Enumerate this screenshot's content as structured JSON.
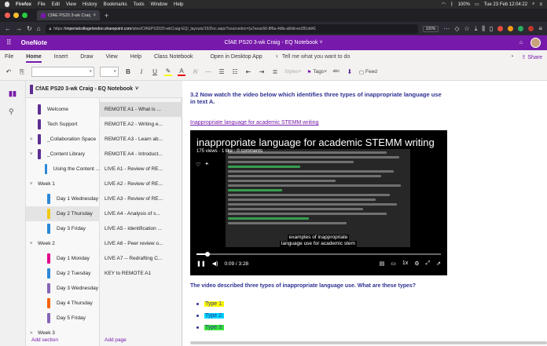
{
  "mac_menu": {
    "app": "Firefox",
    "items": [
      "File",
      "Edit",
      "View",
      "History",
      "Bookmarks",
      "Tools",
      "Window",
      "Help"
    ],
    "battery": "100%",
    "clock": "Tue 23 Feb 12:04:22"
  },
  "browser": {
    "tab_title": "CfAE PS20 3-wk Craig - EQ",
    "url_host": "imperialcollegelondon.sharepoint.com",
    "url_rest": "/sites/CfAEPS2020-wkCraig-EQ/_layouts/15/Doc.aspx?sourcedoc={a7eeac66-8f6a-4dfa-a8dd-ee281dd41",
    "zoom": "100%"
  },
  "onenote": {
    "app_name": "OneNote",
    "doc_title": "CfAE PS20 3-wk Craig - EQ Notebook ˅",
    "ribbon_tabs": [
      "File",
      "Home",
      "Insert",
      "Draw",
      "View",
      "Help",
      "Class Notebook"
    ],
    "open_desktop": "Open in Desktop App",
    "tell_me": "Tell me what you want to do",
    "share": "Share",
    "toolbar": {
      "styles": "Styles",
      "tags": "Tags",
      "feed": "Feed",
      "bold": "B",
      "italic": "I",
      "underline": "U"
    }
  },
  "notebook_name": "CfAE PS20 3-wk Craig - EQ Notebook",
  "sections": [
    {
      "label": "Welcome",
      "color": "#5c2d91",
      "chevron": "",
      "selected": false
    },
    {
      "label": "Tech Support",
      "color": "#5c2d91",
      "chevron": "",
      "selected": false
    },
    {
      "label": "_Collaboration Space",
      "color": "#5c2d91",
      "chevron": ">",
      "selected": false
    },
    {
      "label": "_Content Library",
      "color": "#5c2d91",
      "chevron": "˅",
      "selected": false
    },
    {
      "label": "Using the Content ...",
      "color": "#2b88d8",
      "chevron": "",
      "selected": false
    },
    {
      "label": "Week 1",
      "color": "",
      "chevron": "˅",
      "selected": false
    },
    {
      "label": "Day 1 Wednesday",
      "color": "#2b88d8",
      "chevron": "",
      "selected": false
    },
    {
      "label": "Day 2 Thursday",
      "color": "#f2c811",
      "chevron": "",
      "selected": true
    },
    {
      "label": "Day 3 Friday",
      "color": "#2b88d8",
      "chevron": "",
      "selected": false
    },
    {
      "label": "Week 2",
      "color": "",
      "chevron": "˅",
      "selected": false
    },
    {
      "label": "Day 1 Monday",
      "color": "#e3008c",
      "chevron": "",
      "selected": false
    },
    {
      "label": "Day 2 Tuesday",
      "color": "#2b88d8",
      "chevron": "",
      "selected": false
    },
    {
      "label": "Day 3 Wednesday",
      "color": "#8764b8",
      "chevron": "",
      "selected": false
    },
    {
      "label": "Day 4 Thursday",
      "color": "#f7630c",
      "chevron": "",
      "selected": false
    },
    {
      "label": "Day 5 Friday",
      "color": "#8764b8",
      "chevron": "",
      "selected": false
    },
    {
      "label": "Week 3",
      "color": "",
      "chevron": ">",
      "selected": false
    }
  ],
  "pages": [
    {
      "label": "REMOTE A1 - What is ...",
      "selected": true
    },
    {
      "label": "REMOTE A2 - Writing e...",
      "selected": false
    },
    {
      "label": "REMOTE A3 - Learn ab...",
      "selected": false
    },
    {
      "label": "REMOTE A4 - Introduct...",
      "selected": false
    },
    {
      "label": "LIVE A1 - Review of RE...",
      "selected": false
    },
    {
      "label": "LIVE A2 - Review of RE...",
      "selected": false
    },
    {
      "label": "LIVE A3 - Review of RE...",
      "selected": false
    },
    {
      "label": "LIVE A4 - Analysis of s...",
      "selected": false
    },
    {
      "label": "LIVE A5 - Identification ...",
      "selected": false
    },
    {
      "label": "LIVE A6 - Peer review o...",
      "selected": false
    },
    {
      "label": "LIVE A7 -- Redrafting C...",
      "selected": false
    },
    {
      "label": "KEY to REMOTE A1",
      "selected": false
    }
  ],
  "add_section": "Add section",
  "add_page": "Add page",
  "content": {
    "heading": "3.2 Now watch the video below which identifies three types of inappropriate language use in text A.",
    "link": "Inappropriate language for academic STEMM writing",
    "video": {
      "title": "inappropriate language for academic STEMM writing",
      "meta": "175 views · 1 like · 0 comments",
      "caption_1": "examples of inappropriate",
      "caption_2": "language use for academic stem",
      "time": "0:09 / 3:28",
      "progress": 0.045
    },
    "question": "The video described three types of inappropriate language use. What are these types?",
    "types": [
      {
        "label": "Type 1:",
        "color": "#ffff00"
      },
      {
        "label": "Type 2:",
        "color": "#00d8ff"
      },
      {
        "label": "Type 3:",
        "color": "#39e639"
      }
    ]
  }
}
